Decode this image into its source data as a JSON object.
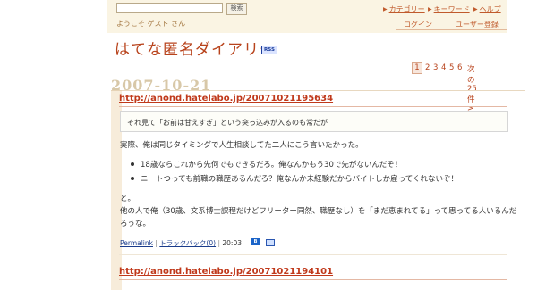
{
  "header": {
    "search_value": "",
    "search_button": "検索",
    "welcome": "ようこそ ゲスト さん",
    "links": {
      "category": "カテゴリー",
      "keyword": "キーワード",
      "help": "ヘルプ",
      "login": "ログイン",
      "register": "ユーザー登録"
    }
  },
  "site": {
    "title": "はてな匿名ダイアリー",
    "rss": "RSS"
  },
  "pager": {
    "current": "1",
    "pages": [
      "2",
      "3",
      "4",
      "5",
      "6"
    ],
    "next": "次の25件>"
  },
  "day": {
    "date": "2007-10-21",
    "entries": [
      {
        "link": "http://anond.hatelabo.jp/20071021195634",
        "quote": "それ見て「お前は甘えすぎ」という突っ込みが入るのも常だが",
        "paragraph1": "実際、俺は同じタイミングで人生相談してた二人にこう言いたかった。",
        "bullets": [
          "18歳ならこれから先何でもできるだろ。俺なんかもう30で先がないんだぞ！",
          "ニートつっても前職の職歴あるんだろ？俺なんか未経験だからバイトしか雇ってくれないぞ！"
        ],
        "paragraph2": "と。",
        "paragraph3_line1": "他の人で俺（30歳、文系博士課程だけどフリーター同然、職歴なし）を「まだ恵まれてる」って思ってる人いるんだ",
        "paragraph3_line2": "ろうな。",
        "footer": {
          "permalink": "Permalink",
          "trackback": "トラックバック(0)",
          "time": "20:03"
        }
      },
      {
        "link": "http://anond.hatelabo.jp/20071021194101"
      }
    ]
  }
}
